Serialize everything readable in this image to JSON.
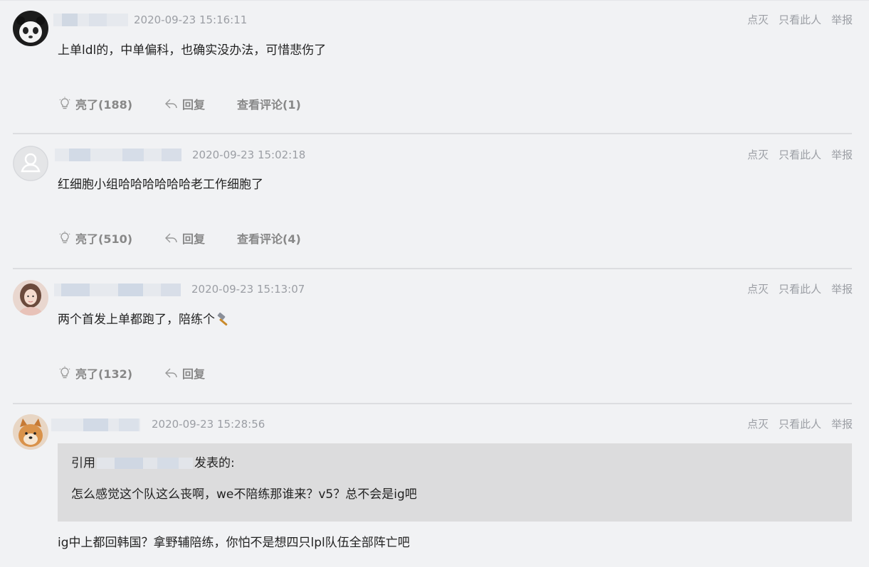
{
  "operations": {
    "report_dislike": "点灭",
    "only_this_user": "只看此人",
    "report": "举报"
  },
  "actions": {
    "light_prefix": "亮了",
    "reply": "回复",
    "view_comments_prefix": "查看评论"
  },
  "comments": [
    {
      "time": "2020-09-23 15:16:11",
      "text": "上单ldl的，中单偏科，也确实没办法，可惜悲伤了",
      "lights": "亮了(188)",
      "reply": "回复",
      "view_comments": "查看评论(1)"
    },
    {
      "time": "2020-09-23 15:02:18",
      "text": "红细胞小组哈哈哈哈哈哈老工作细胞了",
      "lights": "亮了(510)",
      "reply": "回复",
      "view_comments": "查看评论(4)"
    },
    {
      "time": "2020-09-23 15:13:07",
      "text": "两个首发上单都跑了，陪练个",
      "emoji": "hammer-emoji",
      "lights": "亮了(132)",
      "reply": "回复"
    },
    {
      "time": "2020-09-23 15:28:56",
      "quote": {
        "prefix": "引用",
        "suffix": "发表的:",
        "text": "怎么感觉这个队这么丧啊，we不陪练那谁来？v5？总不会是ig吧"
      },
      "text": "ig中上都回韩国？拿野辅陪练，你怕不是想四只lpl队伍全部阵亡吧"
    }
  ],
  "colors": {
    "background": "#f1f2f4",
    "meta_text": "#9b9ea4",
    "action_text": "#888888",
    "quote_bg": "#dcdcdd"
  }
}
